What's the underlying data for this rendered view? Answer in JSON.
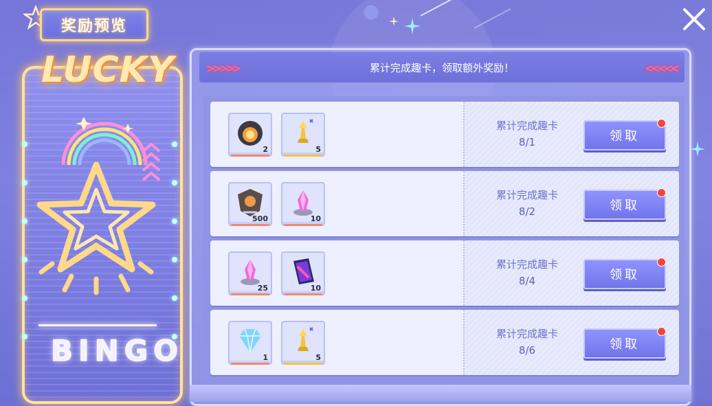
{
  "header": {
    "title": "奖励预览",
    "close_icon": "close-icon"
  },
  "left_panel": {
    "logo_text": "LUCKY",
    "bingo_text": "BINGO"
  },
  "banner": {
    "text": "累计完成趣卡，领取额外奖励！"
  },
  "colors": {
    "accent": "#7175ea",
    "claim_dot": "#f0453d",
    "neon": "#ffd889"
  },
  "rows": [
    {
      "items": [
        {
          "icon": "orb-badge-icon",
          "count": "2",
          "rarity_color": "#f08a6a"
        },
        {
          "icon": "golden-trophy-icon",
          "count": "5",
          "rarity_color": "#f2c544"
        }
      ],
      "condition_label": "累计完成趣卡",
      "condition_value": "8/1",
      "button_label": "领取"
    },
    {
      "items": [
        {
          "icon": "armor-emblem-icon",
          "count": "500",
          "rarity_color": "#f08a6a"
        },
        {
          "icon": "pink-crystal-icon",
          "count": "10",
          "rarity_color": "#f08a6a"
        }
      ],
      "condition_label": "累计完成趣卡",
      "condition_value": "8/2",
      "button_label": "领取"
    },
    {
      "items": [
        {
          "icon": "pink-crystal-icon",
          "count": "25",
          "rarity_color": "#f08a6a"
        },
        {
          "icon": "purple-card-icon",
          "count": "10",
          "rarity_color": "#f08a6a"
        }
      ],
      "condition_label": "累计完成趣卡",
      "condition_value": "8/4",
      "button_label": "领取"
    },
    {
      "items": [
        {
          "icon": "diamond-icon",
          "count": "1",
          "rarity_color": "#f08a6a"
        },
        {
          "icon": "golden-trophy-icon",
          "count": "5",
          "rarity_color": "#f2c544"
        }
      ],
      "condition_label": "累计完成趣卡",
      "condition_value": "8/6",
      "button_label": "领取"
    }
  ]
}
